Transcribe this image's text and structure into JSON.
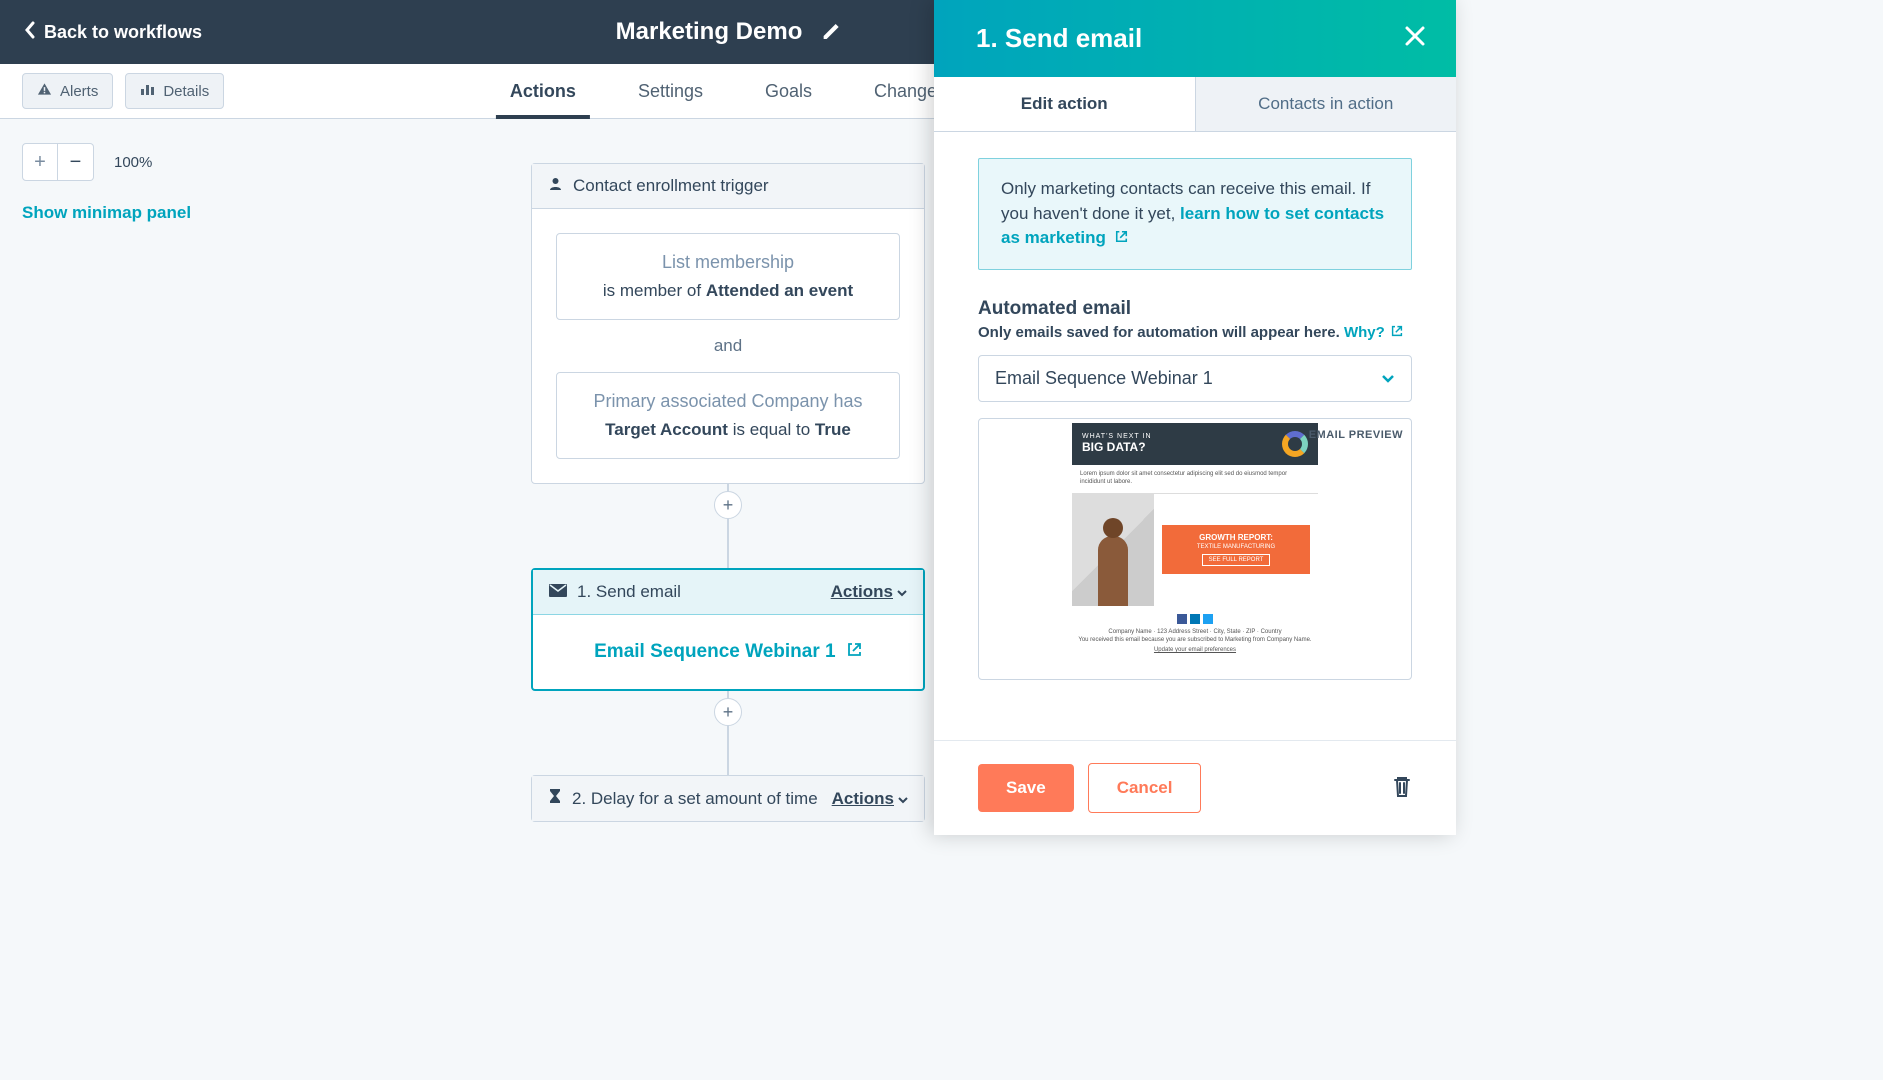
{
  "header": {
    "back_label": "Back to workflows",
    "title": "Marketing Demo"
  },
  "subheader": {
    "alerts_label": "Alerts",
    "details_label": "Details",
    "tabs": {
      "actions": "Actions",
      "settings": "Settings",
      "goals": "Goals",
      "changes": "Changes"
    }
  },
  "canvas": {
    "zoom_level": "100%",
    "minimap_label": "Show minimap panel"
  },
  "trigger_card": {
    "header": "Contact enrollment trigger",
    "filter1_title": "List membership",
    "filter1_pre": "is member of ",
    "filter1_bold": "Attended an event",
    "and": "and",
    "filter2_title": "Primary associated Company has",
    "filter2_bold1": "Target Account",
    "filter2_mid": " is equal to ",
    "filter2_bold2": "True"
  },
  "action1": {
    "title": "1. Send email",
    "actions_label": "Actions",
    "body": "Email Sequence Webinar 1"
  },
  "action2": {
    "title": "2. Delay for a set amount of time",
    "actions_label": "Actions"
  },
  "panel": {
    "title": "1. Send email",
    "tab_edit": "Edit action",
    "tab_contacts": "Contacts in action",
    "notice_pre": "Only marketing contacts can receive this email. If you haven't done it yet, ",
    "notice_link": "learn how to set contacts as marketing",
    "field_label": "Automated email",
    "helper_pre": "Only emails saved for automation will appear here. ",
    "helper_link": "Why?",
    "select_value": "Email Sequence Webinar 1",
    "preview_badge": "EMAIL PREVIEW",
    "mock": {
      "hero_tiny": "WHAT'S NEXT IN",
      "hero_big": "BIG DATA?",
      "cta_h": "GROWTH REPORT:",
      "cta_s": "TEXTILE MANUFACTURING",
      "cta_btn": "SEE FULL REPORT"
    },
    "save": "Save",
    "cancel": "Cancel"
  }
}
